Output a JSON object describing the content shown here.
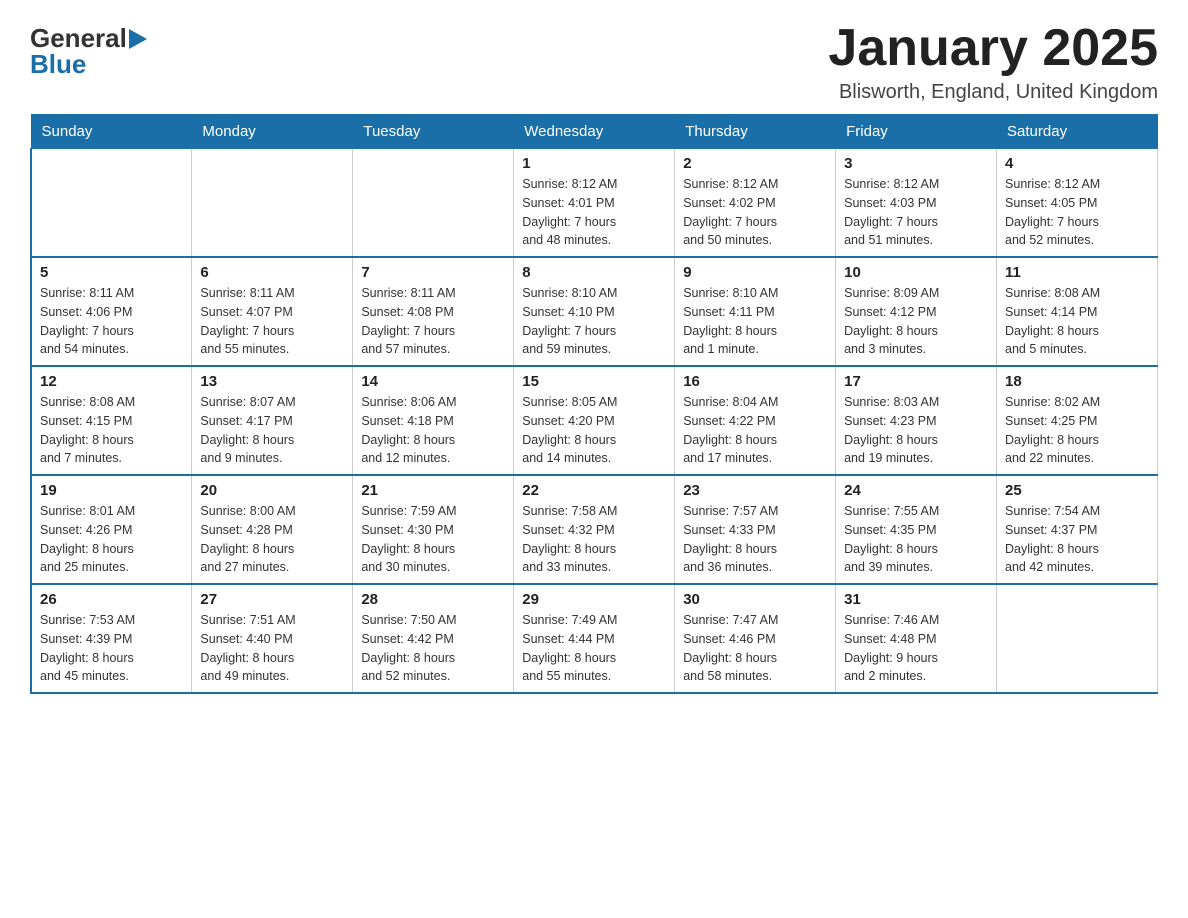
{
  "logo": {
    "text_general": "General",
    "arrow": "▶",
    "text_blue": "Blue"
  },
  "title": "January 2025",
  "subtitle": "Blisworth, England, United Kingdom",
  "days_of_week": [
    "Sunday",
    "Monday",
    "Tuesday",
    "Wednesday",
    "Thursday",
    "Friday",
    "Saturday"
  ],
  "weeks": [
    [
      {
        "day": "",
        "info": ""
      },
      {
        "day": "",
        "info": ""
      },
      {
        "day": "",
        "info": ""
      },
      {
        "day": "1",
        "info": "Sunrise: 8:12 AM\nSunset: 4:01 PM\nDaylight: 7 hours\nand 48 minutes."
      },
      {
        "day": "2",
        "info": "Sunrise: 8:12 AM\nSunset: 4:02 PM\nDaylight: 7 hours\nand 50 minutes."
      },
      {
        "day": "3",
        "info": "Sunrise: 8:12 AM\nSunset: 4:03 PM\nDaylight: 7 hours\nand 51 minutes."
      },
      {
        "day": "4",
        "info": "Sunrise: 8:12 AM\nSunset: 4:05 PM\nDaylight: 7 hours\nand 52 minutes."
      }
    ],
    [
      {
        "day": "5",
        "info": "Sunrise: 8:11 AM\nSunset: 4:06 PM\nDaylight: 7 hours\nand 54 minutes."
      },
      {
        "day": "6",
        "info": "Sunrise: 8:11 AM\nSunset: 4:07 PM\nDaylight: 7 hours\nand 55 minutes."
      },
      {
        "day": "7",
        "info": "Sunrise: 8:11 AM\nSunset: 4:08 PM\nDaylight: 7 hours\nand 57 minutes."
      },
      {
        "day": "8",
        "info": "Sunrise: 8:10 AM\nSunset: 4:10 PM\nDaylight: 7 hours\nand 59 minutes."
      },
      {
        "day": "9",
        "info": "Sunrise: 8:10 AM\nSunset: 4:11 PM\nDaylight: 8 hours\nand 1 minute."
      },
      {
        "day": "10",
        "info": "Sunrise: 8:09 AM\nSunset: 4:12 PM\nDaylight: 8 hours\nand 3 minutes."
      },
      {
        "day": "11",
        "info": "Sunrise: 8:08 AM\nSunset: 4:14 PM\nDaylight: 8 hours\nand 5 minutes."
      }
    ],
    [
      {
        "day": "12",
        "info": "Sunrise: 8:08 AM\nSunset: 4:15 PM\nDaylight: 8 hours\nand 7 minutes."
      },
      {
        "day": "13",
        "info": "Sunrise: 8:07 AM\nSunset: 4:17 PM\nDaylight: 8 hours\nand 9 minutes."
      },
      {
        "day": "14",
        "info": "Sunrise: 8:06 AM\nSunset: 4:18 PM\nDaylight: 8 hours\nand 12 minutes."
      },
      {
        "day": "15",
        "info": "Sunrise: 8:05 AM\nSunset: 4:20 PM\nDaylight: 8 hours\nand 14 minutes."
      },
      {
        "day": "16",
        "info": "Sunrise: 8:04 AM\nSunset: 4:22 PM\nDaylight: 8 hours\nand 17 minutes."
      },
      {
        "day": "17",
        "info": "Sunrise: 8:03 AM\nSunset: 4:23 PM\nDaylight: 8 hours\nand 19 minutes."
      },
      {
        "day": "18",
        "info": "Sunrise: 8:02 AM\nSunset: 4:25 PM\nDaylight: 8 hours\nand 22 minutes."
      }
    ],
    [
      {
        "day": "19",
        "info": "Sunrise: 8:01 AM\nSunset: 4:26 PM\nDaylight: 8 hours\nand 25 minutes."
      },
      {
        "day": "20",
        "info": "Sunrise: 8:00 AM\nSunset: 4:28 PM\nDaylight: 8 hours\nand 27 minutes."
      },
      {
        "day": "21",
        "info": "Sunrise: 7:59 AM\nSunset: 4:30 PM\nDaylight: 8 hours\nand 30 minutes."
      },
      {
        "day": "22",
        "info": "Sunrise: 7:58 AM\nSunset: 4:32 PM\nDaylight: 8 hours\nand 33 minutes."
      },
      {
        "day": "23",
        "info": "Sunrise: 7:57 AM\nSunset: 4:33 PM\nDaylight: 8 hours\nand 36 minutes."
      },
      {
        "day": "24",
        "info": "Sunrise: 7:55 AM\nSunset: 4:35 PM\nDaylight: 8 hours\nand 39 minutes."
      },
      {
        "day": "25",
        "info": "Sunrise: 7:54 AM\nSunset: 4:37 PM\nDaylight: 8 hours\nand 42 minutes."
      }
    ],
    [
      {
        "day": "26",
        "info": "Sunrise: 7:53 AM\nSunset: 4:39 PM\nDaylight: 8 hours\nand 45 minutes."
      },
      {
        "day": "27",
        "info": "Sunrise: 7:51 AM\nSunset: 4:40 PM\nDaylight: 8 hours\nand 49 minutes."
      },
      {
        "day": "28",
        "info": "Sunrise: 7:50 AM\nSunset: 4:42 PM\nDaylight: 8 hours\nand 52 minutes."
      },
      {
        "day": "29",
        "info": "Sunrise: 7:49 AM\nSunset: 4:44 PM\nDaylight: 8 hours\nand 55 minutes."
      },
      {
        "day": "30",
        "info": "Sunrise: 7:47 AM\nSunset: 4:46 PM\nDaylight: 8 hours\nand 58 minutes."
      },
      {
        "day": "31",
        "info": "Sunrise: 7:46 AM\nSunset: 4:48 PM\nDaylight: 9 hours\nand 2 minutes."
      },
      {
        "day": "",
        "info": ""
      }
    ]
  ]
}
